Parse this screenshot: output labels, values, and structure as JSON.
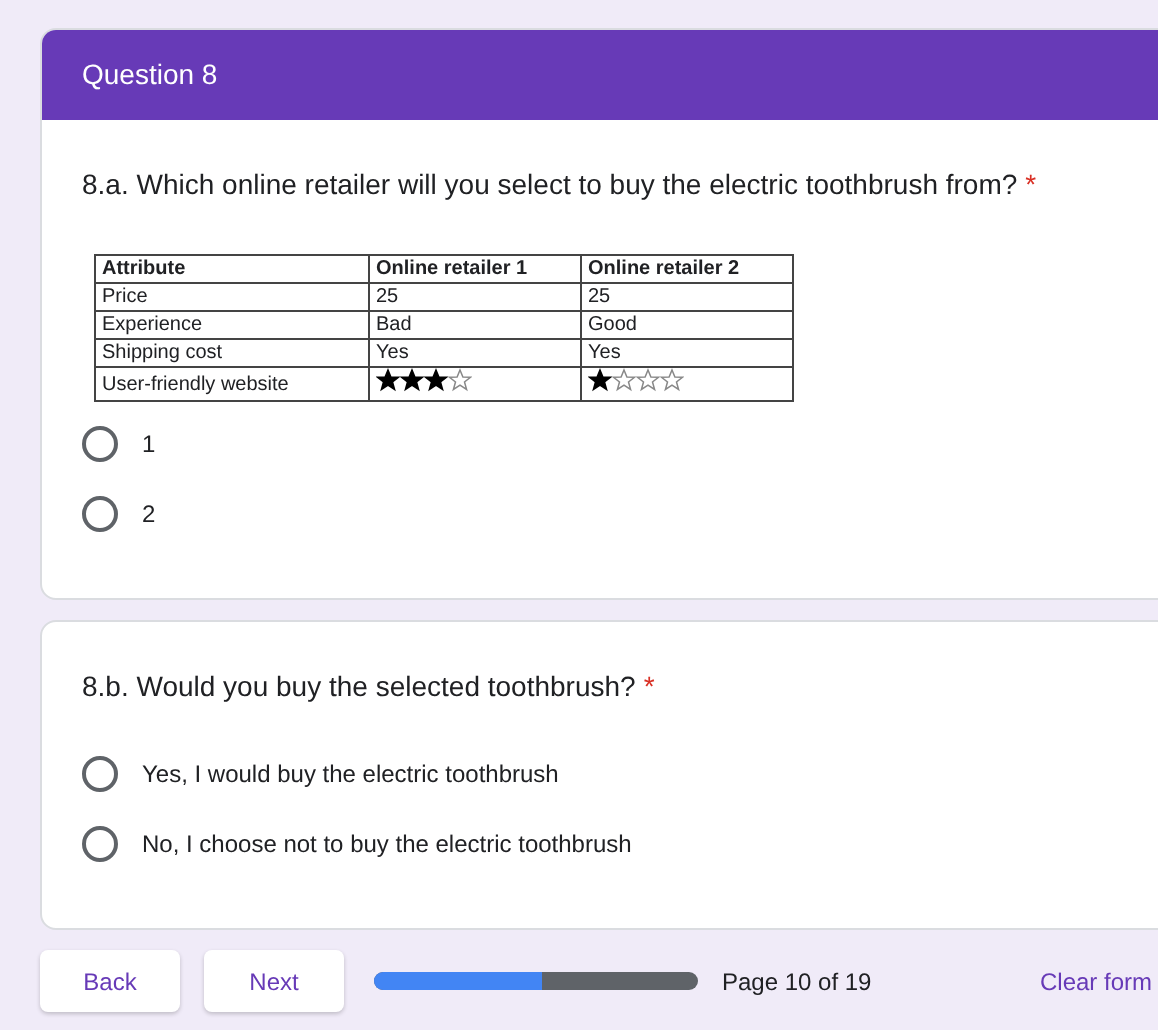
{
  "section_header": {
    "title": "Question 8"
  },
  "questions": [
    {
      "title": "8.a. Which online retailer will you select to buy the electric toothbrush from?",
      "required_mark": "*",
      "table": {
        "columns": [
          "Attribute",
          "Online retailer 1",
          "Online retailer 2"
        ],
        "rows": [
          {
            "kind": "text",
            "cells": [
              "Price",
              "25",
              "25"
            ]
          },
          {
            "kind": "text",
            "cells": [
              "Experience",
              "Bad",
              "Good"
            ]
          },
          {
            "kind": "text",
            "cells": [
              "Shipping cost",
              "Yes",
              "Yes"
            ]
          },
          {
            "kind": "stars",
            "label": "User-friendly website",
            "ratings": [
              {
                "stars": 3
              },
              {
                "stars": 1
              }
            ]
          }
        ]
      },
      "options": [
        {
          "label": "1",
          "selected": false
        },
        {
          "label": "2",
          "selected": false
        }
      ]
    },
    {
      "title": "8.b. Would you buy the selected toothbrush?",
      "required_mark": "*",
      "options": [
        {
          "label": "Yes, I would buy the electric toothbrush",
          "selected": false
        },
        {
          "label": "No, I choose not to buy the electric toothbrush",
          "selected": false
        }
      ]
    }
  ],
  "footer": {
    "back": "Back",
    "next": "Next",
    "progress": {
      "level": 0.52
    },
    "page": "Page 10 of 19",
    "clear": "Clear form"
  }
}
